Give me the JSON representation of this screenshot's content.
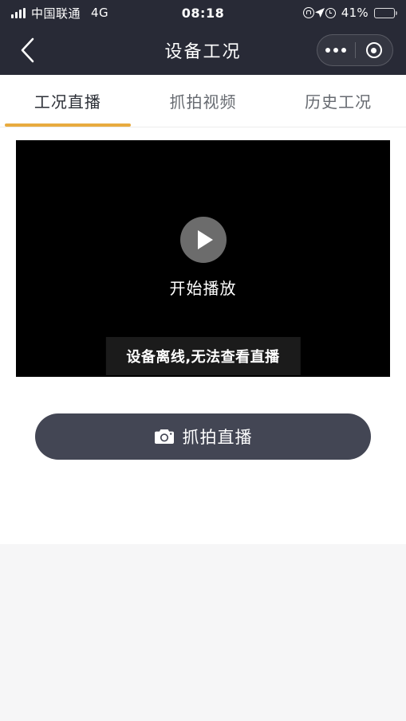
{
  "statusbar": {
    "carrier": "中国联通",
    "network": "4G",
    "time": "08:18",
    "battery_pct": "41%",
    "battery_level": 41,
    "icons": [
      "signal-bars-icon",
      "rotation-lock-icon",
      "location-arrow-icon",
      "alarm-clock-icon",
      "battery-icon"
    ]
  },
  "navbar": {
    "title": "设备工况",
    "back_icon": "chevron-left-icon",
    "capsule": {
      "menu_icon": "more-dots-icon",
      "target_icon": "circle-target-icon"
    }
  },
  "tabs": [
    {
      "label": "工况直播",
      "active": true
    },
    {
      "label": "抓拍视频",
      "active": false
    },
    {
      "label": "历史工况",
      "active": false
    }
  ],
  "player": {
    "play_icon": "play-triangle-icon",
    "play_label": "开始播放",
    "offline_message": "设备离线,无法查看直播"
  },
  "actions": {
    "capture": {
      "label": "抓拍直播",
      "icon": "camera-icon"
    }
  },
  "colors": {
    "header_bg": "#282a36",
    "accent": "#e8ab3f",
    "button_bg": "#434654",
    "page_bg": "#f6f6f7",
    "card_bg": "#ffffff",
    "video_bg": "#000000"
  }
}
